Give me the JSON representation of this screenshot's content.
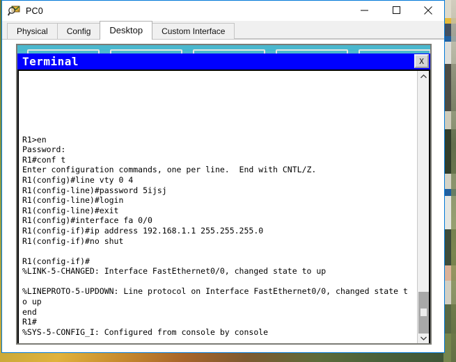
{
  "window": {
    "title": "PC0",
    "app_icon": "packet-tracer-icon",
    "controls": {
      "minimize": "—",
      "maximize": "☐",
      "close": "✕"
    }
  },
  "tabs": [
    {
      "label": "Physical",
      "active": false
    },
    {
      "label": "Config",
      "active": false
    },
    {
      "label": "Desktop",
      "active": true
    },
    {
      "label": "Custom Interface",
      "active": false
    }
  ],
  "desktop": {
    "background_color": "#4ab8ce",
    "icon_tiles": [
      {
        "name": "desktop-icon-tile-1"
      },
      {
        "name": "desktop-icon-tile-2"
      },
      {
        "name": "desktop-icon-tile-3"
      },
      {
        "name": "desktop-icon-tile-4"
      },
      {
        "name": "desktop-icon-tile-5"
      }
    ]
  },
  "terminal": {
    "title": "Terminal",
    "titlebar_color": "#0000ff",
    "close_label": "X",
    "scrollbar": {
      "up_arrow": "▲",
      "down_arrow": "▼",
      "thumb_position": "bottom"
    },
    "output": "\n\n\n\n\n\nR1>en\nPassword:\nR1#conf t\nEnter configuration commands, one per line.  End with CNTL/Z.\nR1(config)#line vty 0 4\nR1(config-line)#password 5ijsj\nR1(config-line)#login\nR1(config-line)#exit\nR1(config)#interface fa 0/0\nR1(config-if)#ip address 192.168.1.1 255.255.255.0\nR1(config-if)#no shut\n\nR1(config-if)#\n%LINK-5-CHANGED: Interface FastEthernet0/0, changed state to up\n\n%LINEPROTO-5-UPDOWN: Line protocol on Interface FastEthernet0/0, changed state t\no up\nend\nR1#\n%SYS-5-CONFIG_I: Configured from console by console"
  }
}
